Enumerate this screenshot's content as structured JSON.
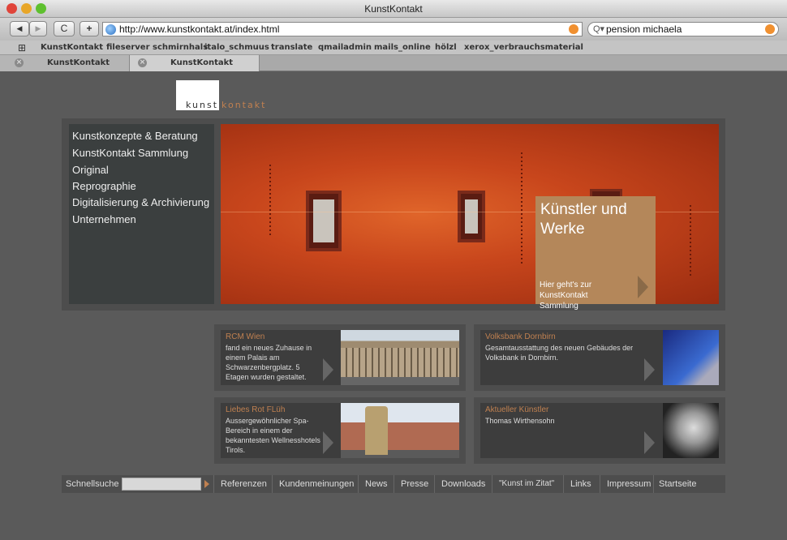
{
  "window": {
    "title": "KunstKontakt"
  },
  "toolbar": {
    "url": "http://www.kunstkontakt.at/index.html",
    "search_value": "pension michaela",
    "back_label": "◀",
    "forward_label": "▶",
    "reload_label": "C",
    "add_label": "+"
  },
  "bookmarks": [
    "KunstKontakt",
    "fileserver schmirnhals",
    "italo_schmuus",
    "translate",
    "qmailadmin",
    "mails_online",
    "hölzl",
    "xerox_verbrauchsmaterial"
  ],
  "tabs": [
    "KunstKontakt",
    "KunstKontakt"
  ],
  "logo": {
    "part1": "kunst",
    "part2": "kontakt"
  },
  "menu": [
    "Kunstkonzepte & Beratung",
    "KunstKontakt Sammlung",
    "Original",
    "Reprographie",
    "Digitalisierung & Archivierung",
    "Unternehmen"
  ],
  "hero": {
    "cta_title": "Künstler und Werke",
    "cta_sub": "Hier geht's zur KunstKontakt Sammlung"
  },
  "cards": [
    {
      "title": "RCM Wien",
      "text": "fand ein neues Zuhause in einem Palais am Schwarzenbergplatz. 5 Etagen wurden gestaltet."
    },
    {
      "title": "Volksbank Dornbirn",
      "text": "Gesamtausstattung des neuen Gebäudes der Volksbank in Dornbirn."
    },
    {
      "title": "Liebes Rot FLüh",
      "text": "Aussergewöhnlicher Spa-Bereich in einem der bekanntesten Wellnesshotels Tirols."
    },
    {
      "title": "Aktueller Künstler",
      "text": "Thomas Wirthensohn"
    }
  ],
  "footer": {
    "quicksearch_label": "Schnellsuche",
    "links": [
      "Referenzen",
      "Kundenmeinungen",
      "News",
      "Presse",
      "Downloads",
      "\"Kunst im Zitat\"",
      "Links",
      "Impressum",
      "Startseite"
    ]
  },
  "colors": {
    "accent": "#c08050",
    "cta": "#b4875a",
    "page_bg": "#5a5a5a"
  }
}
